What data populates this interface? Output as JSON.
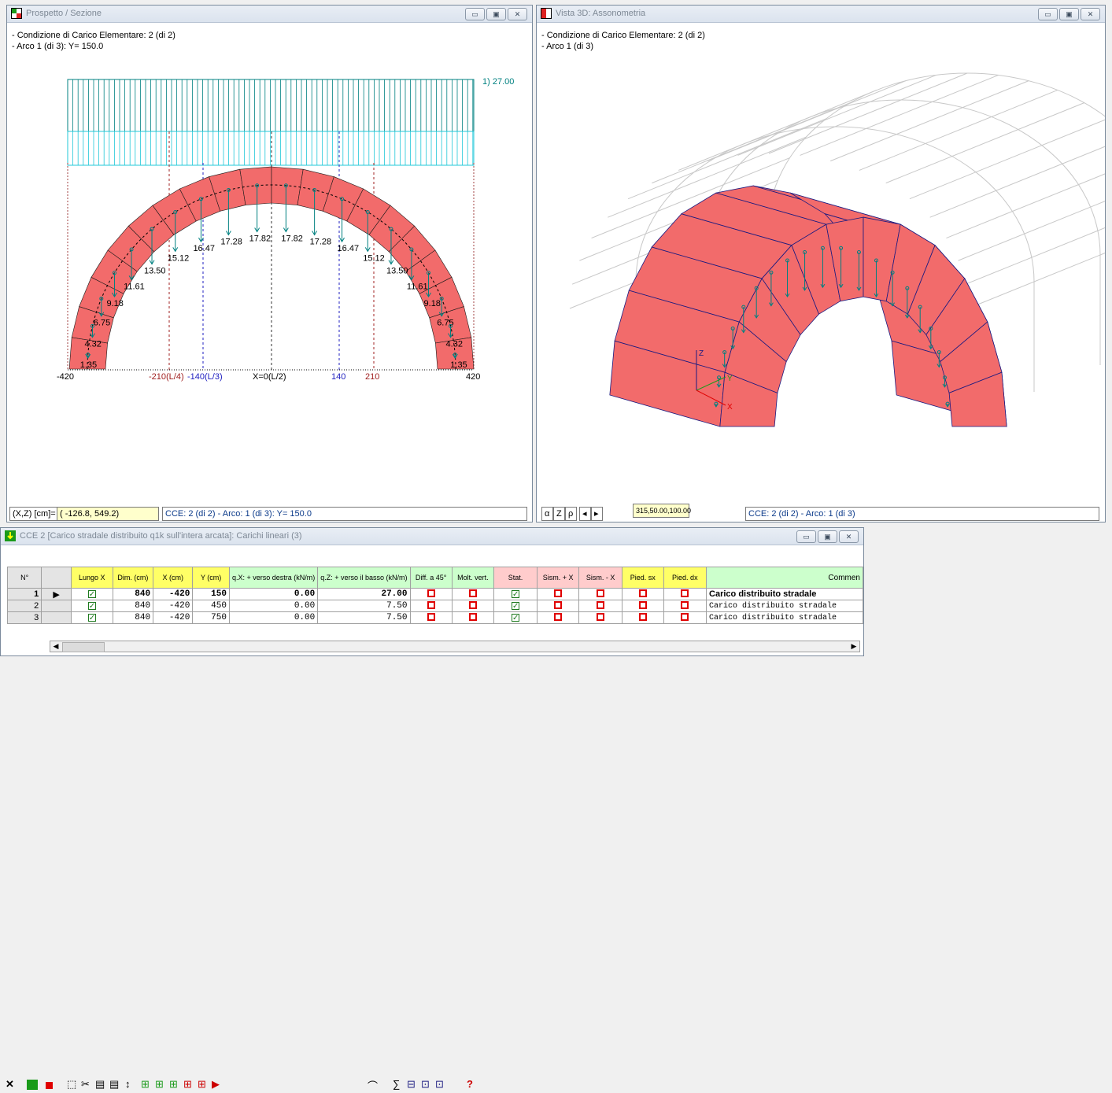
{
  "left_window": {
    "title": "Prospetto / Sezione",
    "info_line1": "- Condizione di Carico Elementare: 2  (di 2)",
    "info_line2": "- Arco 1 (di 3): Y= 150.0",
    "load_label": "1) 27.00",
    "load_values_left": [
      "1.35",
      "4.32",
      "6.75",
      "9.18",
      "11.61",
      "13.50",
      "15.12",
      "16.47",
      "17.28",
      "17.82"
    ],
    "load_values_right": [
      "17.82",
      "17.28",
      "16.47",
      "15.12",
      "13.50",
      "11.61",
      "9.18",
      "6.75",
      "4.32",
      "1.35"
    ],
    "axis_labels": {
      "x_min": "-420",
      "l4": "-210(L/4)",
      "l3": "-140(L/3)",
      "center": "X=0(L/2)",
      "p140": "140",
      "p210": "210",
      "x_max": "420"
    },
    "coord_label": "(X,Z) [cm]=",
    "coord_value": "( -126.8, 549.2)",
    "status": "CCE: 2  (di 2) - Arco: 1 (di 3): Y= 150.0"
  },
  "right_window": {
    "title": "Vista 3D: Assonometria",
    "info_line1": "- Condizione di Carico Elementare: 2  (di 2)",
    "info_line2": "- Arco 1 (di 3)",
    "axes": {
      "z": "Z",
      "y": "Y",
      "x": "X"
    },
    "view_buttons": [
      "α",
      "Z",
      "ρ"
    ],
    "view_params": "315,50.00,100.00",
    "status": "CCE: 2  (di 2) - Arco: 1 (di 3)"
  },
  "table_window": {
    "title": "CCE 2 [Carico stradale distribuito q1k sull'intera arcata]: Carichi lineari (3)",
    "close_glyph": "✕",
    "help_glyph": "?",
    "sum_glyph": "∑",
    "headers": [
      "N°",
      "",
      "Lungo X",
      "Dim. (cm)",
      "X (cm)",
      "Y (cm)",
      "q.X: + verso destra (kN/m)",
      "q.Z: + verso il basso (kN/m)",
      "Diff. a 45°",
      "Molt. vert.",
      "Stat.",
      "Sism. + X",
      "Sism. - X",
      "Pied. sx",
      "Pied. dx",
      "Commen"
    ],
    "rows": [
      {
        "n": "1",
        "marker": "▶",
        "dim": "840",
        "x": "-420",
        "y": "150",
        "qx": "0.00",
        "qz": "27.00",
        "comment": "Carico distribuito stradale"
      },
      {
        "n": "2",
        "marker": "",
        "dim": "840",
        "x": "-420",
        "y": "450",
        "qx": "0.00",
        "qz": "7.50",
        "comment": "Carico distribuito stradale"
      },
      {
        "n": "3",
        "marker": "",
        "dim": "840",
        "x": "-420",
        "y": "750",
        "qx": "0.00",
        "qz": "7.50",
        "comment": "Carico distribuito stradale"
      }
    ]
  },
  "colors": {
    "arch_fill": "#f26b6b",
    "arch_stroke": "#1a1a80",
    "load_color": "#008080",
    "cyan": "#22c8d8",
    "green": "#1f7a1f",
    "red": "#e00000"
  }
}
